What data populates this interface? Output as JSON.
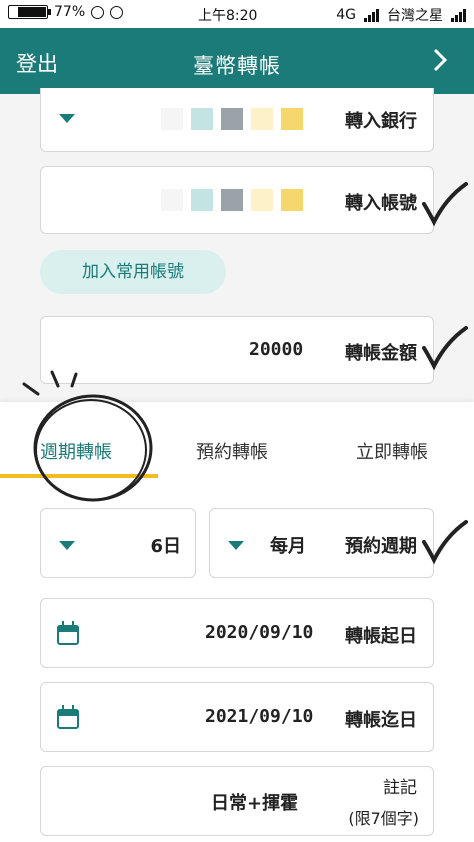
{
  "status_bar": {
    "battery": "77%",
    "time": "上午8:20",
    "network": "4G",
    "carrier": "台灣之星"
  },
  "app_bar": {
    "login_label": "登出",
    "title": "臺幣轉帳"
  },
  "form": {
    "receiving_bank_label": "轉入銀行",
    "receiving_account_label": "轉入帳號",
    "add_common_account_label": "加入常用帳號",
    "amount_label": "轉帳金額",
    "amount_value": "20000"
  },
  "tabs": [
    {
      "label": "週期轉帳",
      "active": true
    },
    {
      "label": "預約轉帳",
      "active": false
    },
    {
      "label": "立即轉帳",
      "active": false
    }
  ],
  "schedule": {
    "period_label": "預約週期",
    "period_value": "每月",
    "day_value": "6日",
    "start_label": "轉帳起日",
    "start_value": "2020/09/10",
    "end_label": "轉帳迄日",
    "end_value": "2021/09/10",
    "note_label": "註記",
    "note_hint": "(限7個字)",
    "note_value": "日常+揮霍"
  },
  "colors": {
    "primary": "#1a7b79",
    "accent": "#f2be1e",
    "pill_bg": "#d9f0ee"
  },
  "masked_blocks": [
    "#f6d76c",
    "#fdf2c7",
    "#9aa3a7",
    "#c4e3e3",
    "#f5f5f5"
  ]
}
